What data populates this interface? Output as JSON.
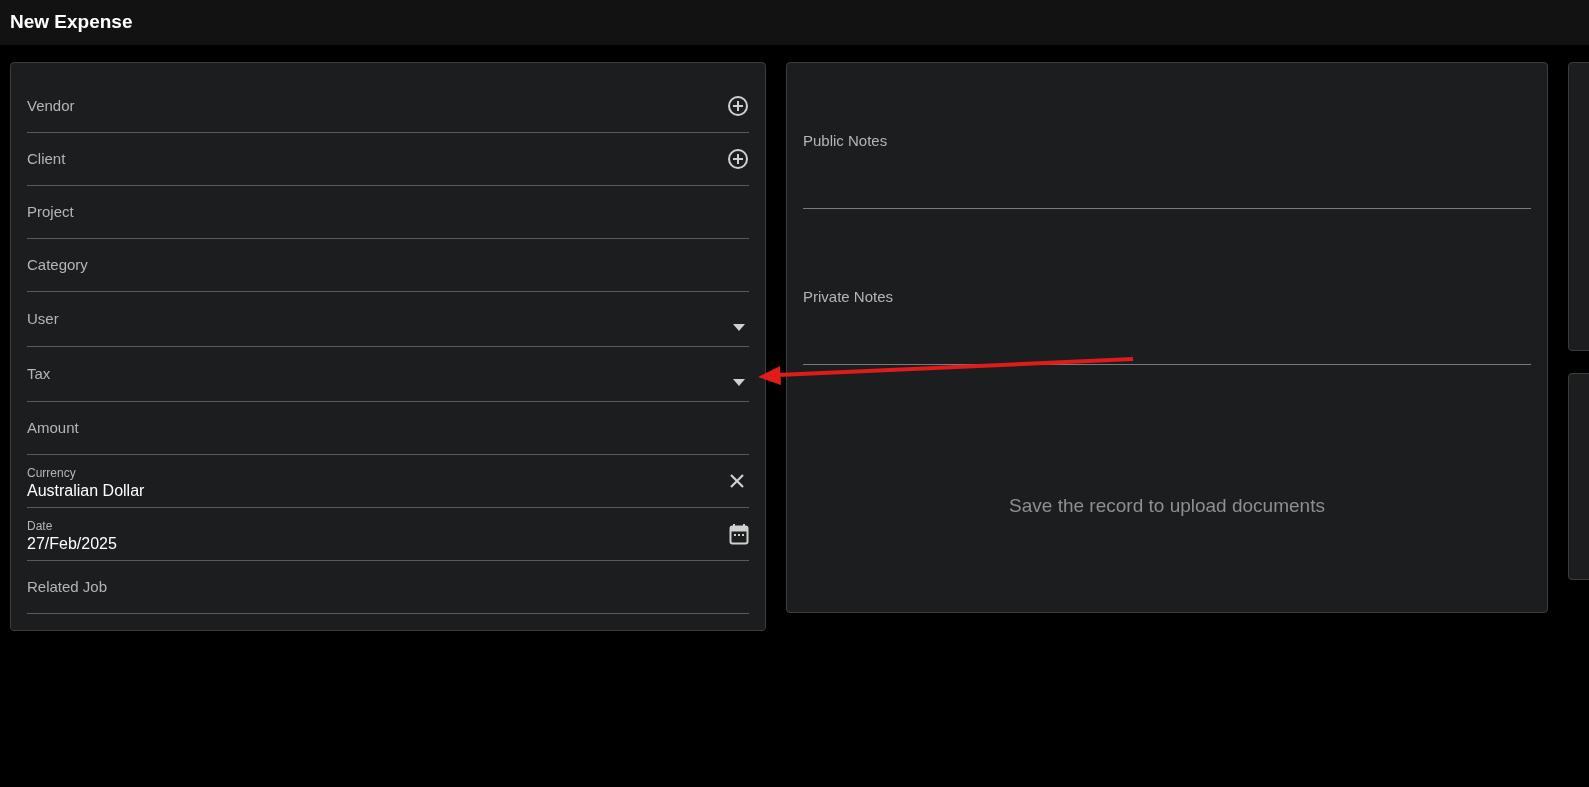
{
  "header": {
    "title": "New Expense"
  },
  "fields": [
    {
      "label": "Vendor",
      "kind": "add"
    },
    {
      "label": "Client",
      "kind": "add"
    },
    {
      "label": "Project",
      "kind": "plain"
    },
    {
      "label": "Category",
      "kind": "plain"
    },
    {
      "label": "User",
      "kind": "dropdown"
    },
    {
      "label": "Tax",
      "kind": "dropdown"
    },
    {
      "label": "Amount",
      "kind": "plain"
    },
    {
      "label": "Currency",
      "value": "Australian Dollar",
      "kind": "clear"
    },
    {
      "label": "Date",
      "value": "27/Feb/2025",
      "kind": "calendar"
    },
    {
      "label": "Related Job",
      "kind": "plain"
    }
  ],
  "notes": [
    {
      "label": "Public Notes"
    },
    {
      "label": "Private Notes"
    }
  ],
  "documents": {
    "message": "Save the record to upload documents"
  }
}
